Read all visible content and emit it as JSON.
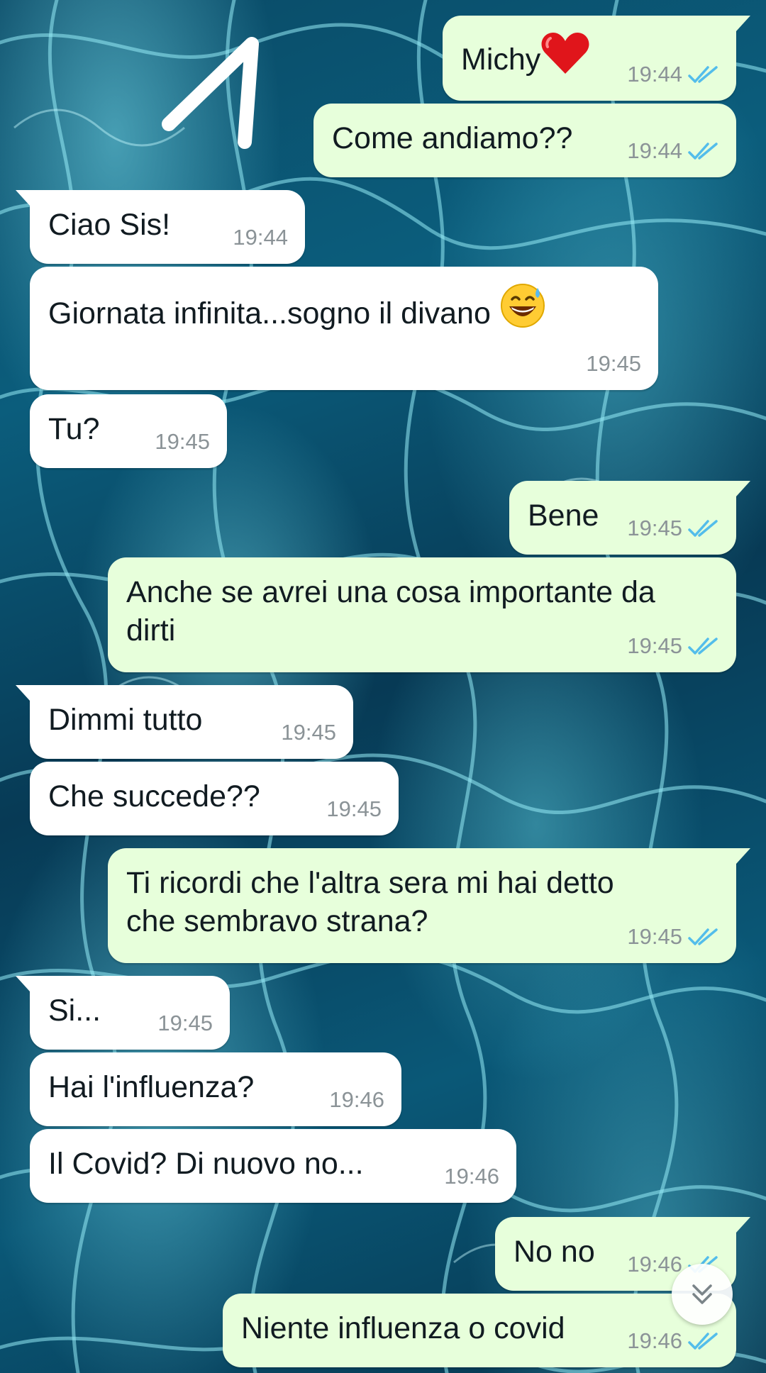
{
  "chat": {
    "messages": [
      {
        "id": 1,
        "direction": "out",
        "text": "Michy",
        "emoji": "heart-emoji",
        "time": "19:44",
        "status": "read"
      },
      {
        "id": 2,
        "direction": "out",
        "text": "Come andiamo??",
        "time": "19:44",
        "status": "read"
      },
      {
        "id": 3,
        "direction": "in",
        "text": "Ciao Sis!",
        "time": "19:44"
      },
      {
        "id": 4,
        "direction": "in",
        "text": "Giornata infinita...sogno il divano",
        "emoji": "grinning-sweat-emoji",
        "time": "19:45"
      },
      {
        "id": 5,
        "direction": "in",
        "text": "Tu?",
        "time": "19:45"
      },
      {
        "id": 6,
        "direction": "out",
        "text": "Bene",
        "time": "19:45",
        "status": "read"
      },
      {
        "id": 7,
        "direction": "out",
        "text": "Anche se avrei una cosa importante da\ndirti",
        "time": "19:45",
        "status": "read"
      },
      {
        "id": 8,
        "direction": "in",
        "text": "Dimmi tutto",
        "time": "19:45"
      },
      {
        "id": 9,
        "direction": "in",
        "text": "Che succede??",
        "time": "19:45"
      },
      {
        "id": 10,
        "direction": "out",
        "text": "Ti ricordi che l'altra sera mi hai detto\nche sembravo strana?",
        "time": "19:45",
        "status": "read"
      },
      {
        "id": 11,
        "direction": "in",
        "text": "Si...",
        "time": "19:45"
      },
      {
        "id": 12,
        "direction": "in",
        "text": "Hai l'influenza?",
        "time": "19:46"
      },
      {
        "id": 13,
        "direction": "in",
        "text": "Il Covid? Di nuovo no...",
        "time": "19:46"
      },
      {
        "id": 14,
        "direction": "out",
        "text": "No no",
        "time": "19:46",
        "status": "read"
      },
      {
        "id": 15,
        "direction": "out",
        "text": "Niente influenza o covid",
        "time": "19:46",
        "status": "read"
      }
    ]
  },
  "colors": {
    "outgoing_bubble": "#e7ffdb",
    "incoming_bubble": "#ffffff",
    "timestamp": "#8b9397",
    "read_ticks": "#53bdeb",
    "wallpaper": "#0a4a66"
  },
  "icons": {
    "read_receipt": "double-check-icon",
    "scroll_down": "chevron-double-down-icon"
  }
}
